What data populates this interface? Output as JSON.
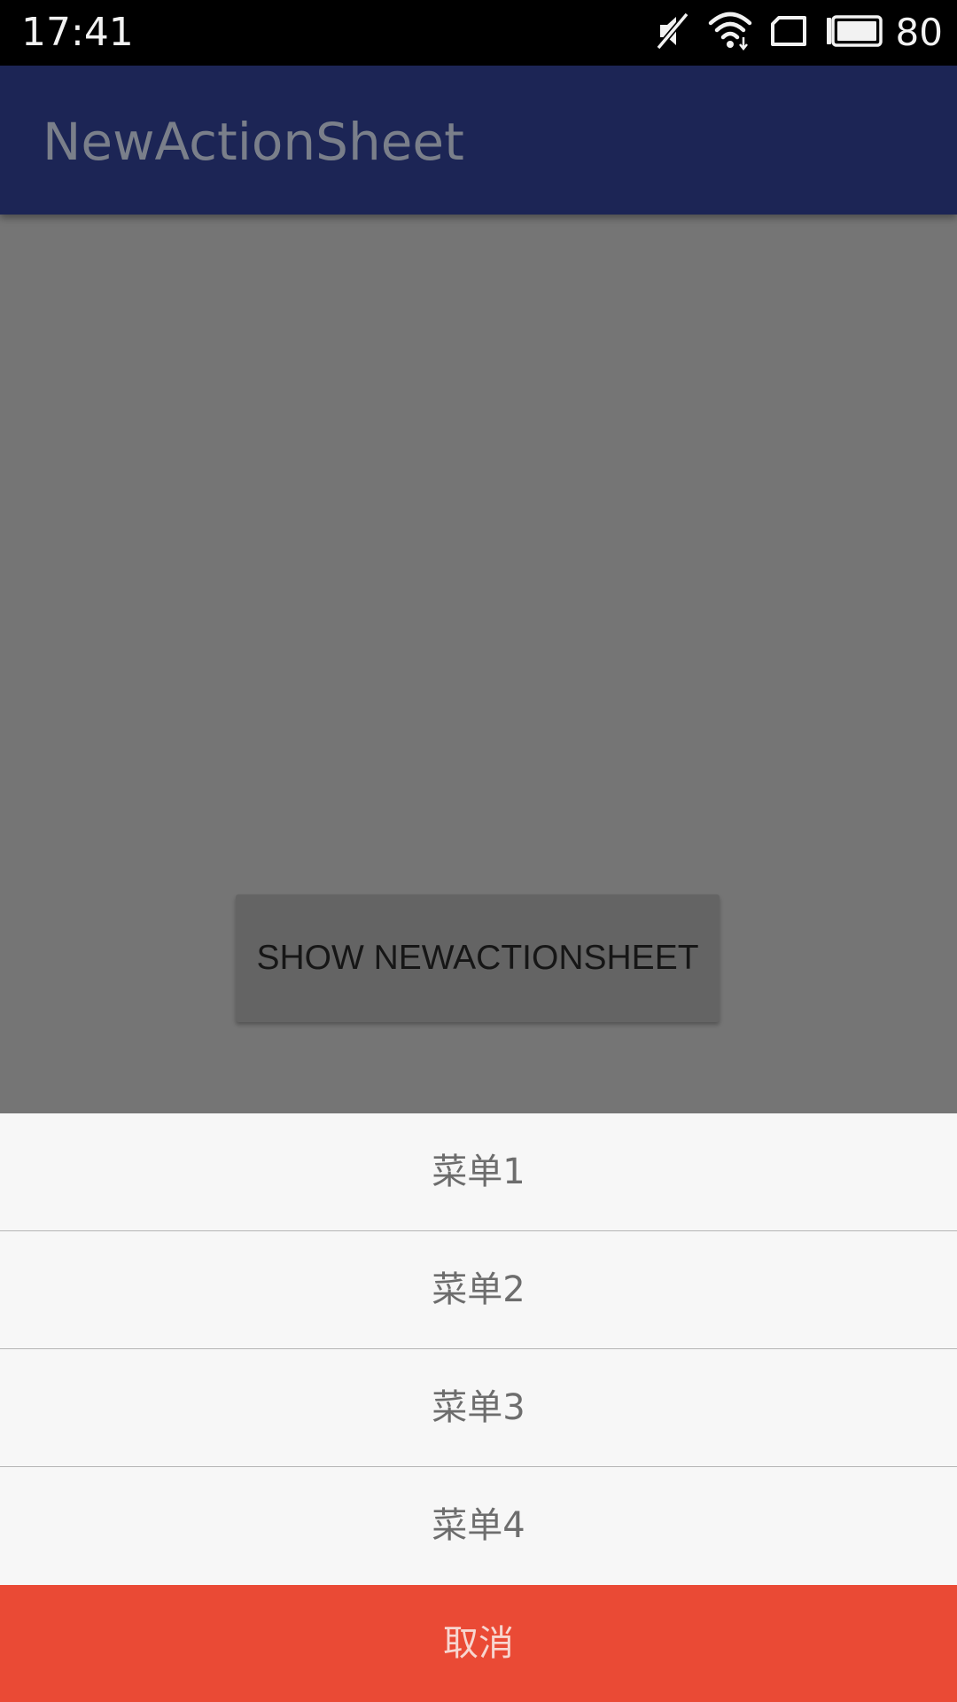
{
  "status_bar": {
    "time": "17:41",
    "battery_level": "80",
    "icons": [
      "mute-icon",
      "wifi-icon",
      "sim-card-icon",
      "battery-icon"
    ]
  },
  "app_bar": {
    "title": "NewActionSheet",
    "background_color": "#1c2555"
  },
  "main": {
    "show_button_label": "SHOW NEWACTIONSHEET"
  },
  "action_sheet": {
    "items": [
      {
        "label": "菜单1"
      },
      {
        "label": "菜单2"
      },
      {
        "label": "菜单3"
      },
      {
        "label": "菜单4"
      }
    ],
    "cancel_label": "取消",
    "cancel_color": "#ea4a35"
  }
}
